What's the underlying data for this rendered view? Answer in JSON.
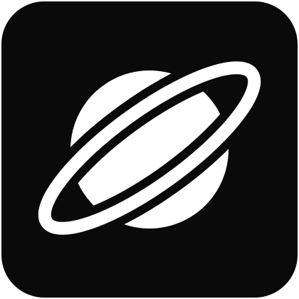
{
  "app_icon": {
    "icon": "planet-ring-icon",
    "background_color": "#0a0a0a",
    "glyph_color": "#ffffff",
    "page_background": "#ffffff"
  }
}
